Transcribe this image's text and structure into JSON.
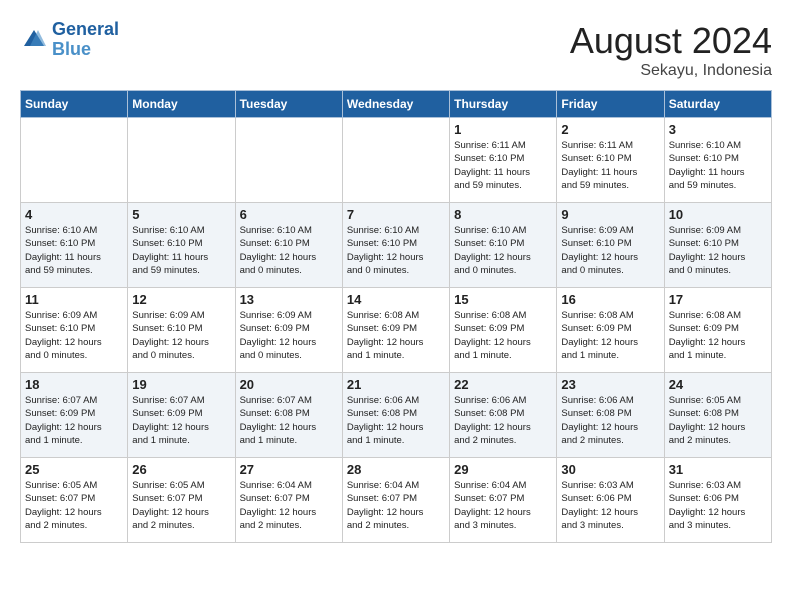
{
  "header": {
    "logo_line1": "General",
    "logo_line2": "Blue",
    "month_year": "August 2024",
    "location": "Sekayu, Indonesia"
  },
  "weekdays": [
    "Sunday",
    "Monday",
    "Tuesday",
    "Wednesday",
    "Thursday",
    "Friday",
    "Saturday"
  ],
  "weeks": [
    [
      {
        "day": "",
        "info": ""
      },
      {
        "day": "",
        "info": ""
      },
      {
        "day": "",
        "info": ""
      },
      {
        "day": "",
        "info": ""
      },
      {
        "day": "1",
        "info": "Sunrise: 6:11 AM\nSunset: 6:10 PM\nDaylight: 11 hours\nand 59 minutes."
      },
      {
        "day": "2",
        "info": "Sunrise: 6:11 AM\nSunset: 6:10 PM\nDaylight: 11 hours\nand 59 minutes."
      },
      {
        "day": "3",
        "info": "Sunrise: 6:10 AM\nSunset: 6:10 PM\nDaylight: 11 hours\nand 59 minutes."
      }
    ],
    [
      {
        "day": "4",
        "info": "Sunrise: 6:10 AM\nSunset: 6:10 PM\nDaylight: 11 hours\nand 59 minutes."
      },
      {
        "day": "5",
        "info": "Sunrise: 6:10 AM\nSunset: 6:10 PM\nDaylight: 11 hours\nand 59 minutes."
      },
      {
        "day": "6",
        "info": "Sunrise: 6:10 AM\nSunset: 6:10 PM\nDaylight: 12 hours\nand 0 minutes."
      },
      {
        "day": "7",
        "info": "Sunrise: 6:10 AM\nSunset: 6:10 PM\nDaylight: 12 hours\nand 0 minutes."
      },
      {
        "day": "8",
        "info": "Sunrise: 6:10 AM\nSunset: 6:10 PM\nDaylight: 12 hours\nand 0 minutes."
      },
      {
        "day": "9",
        "info": "Sunrise: 6:09 AM\nSunset: 6:10 PM\nDaylight: 12 hours\nand 0 minutes."
      },
      {
        "day": "10",
        "info": "Sunrise: 6:09 AM\nSunset: 6:10 PM\nDaylight: 12 hours\nand 0 minutes."
      }
    ],
    [
      {
        "day": "11",
        "info": "Sunrise: 6:09 AM\nSunset: 6:10 PM\nDaylight: 12 hours\nand 0 minutes."
      },
      {
        "day": "12",
        "info": "Sunrise: 6:09 AM\nSunset: 6:10 PM\nDaylight: 12 hours\nand 0 minutes."
      },
      {
        "day": "13",
        "info": "Sunrise: 6:09 AM\nSunset: 6:09 PM\nDaylight: 12 hours\nand 0 minutes."
      },
      {
        "day": "14",
        "info": "Sunrise: 6:08 AM\nSunset: 6:09 PM\nDaylight: 12 hours\nand 1 minute."
      },
      {
        "day": "15",
        "info": "Sunrise: 6:08 AM\nSunset: 6:09 PM\nDaylight: 12 hours\nand 1 minute."
      },
      {
        "day": "16",
        "info": "Sunrise: 6:08 AM\nSunset: 6:09 PM\nDaylight: 12 hours\nand 1 minute."
      },
      {
        "day": "17",
        "info": "Sunrise: 6:08 AM\nSunset: 6:09 PM\nDaylight: 12 hours\nand 1 minute."
      }
    ],
    [
      {
        "day": "18",
        "info": "Sunrise: 6:07 AM\nSunset: 6:09 PM\nDaylight: 12 hours\nand 1 minute."
      },
      {
        "day": "19",
        "info": "Sunrise: 6:07 AM\nSunset: 6:09 PM\nDaylight: 12 hours\nand 1 minute."
      },
      {
        "day": "20",
        "info": "Sunrise: 6:07 AM\nSunset: 6:08 PM\nDaylight: 12 hours\nand 1 minute."
      },
      {
        "day": "21",
        "info": "Sunrise: 6:06 AM\nSunset: 6:08 PM\nDaylight: 12 hours\nand 1 minute."
      },
      {
        "day": "22",
        "info": "Sunrise: 6:06 AM\nSunset: 6:08 PM\nDaylight: 12 hours\nand 2 minutes."
      },
      {
        "day": "23",
        "info": "Sunrise: 6:06 AM\nSunset: 6:08 PM\nDaylight: 12 hours\nand 2 minutes."
      },
      {
        "day": "24",
        "info": "Sunrise: 6:05 AM\nSunset: 6:08 PM\nDaylight: 12 hours\nand 2 minutes."
      }
    ],
    [
      {
        "day": "25",
        "info": "Sunrise: 6:05 AM\nSunset: 6:07 PM\nDaylight: 12 hours\nand 2 minutes."
      },
      {
        "day": "26",
        "info": "Sunrise: 6:05 AM\nSunset: 6:07 PM\nDaylight: 12 hours\nand 2 minutes."
      },
      {
        "day": "27",
        "info": "Sunrise: 6:04 AM\nSunset: 6:07 PM\nDaylight: 12 hours\nand 2 minutes."
      },
      {
        "day": "28",
        "info": "Sunrise: 6:04 AM\nSunset: 6:07 PM\nDaylight: 12 hours\nand 2 minutes."
      },
      {
        "day": "29",
        "info": "Sunrise: 6:04 AM\nSunset: 6:07 PM\nDaylight: 12 hours\nand 3 minutes."
      },
      {
        "day": "30",
        "info": "Sunrise: 6:03 AM\nSunset: 6:06 PM\nDaylight: 12 hours\nand 3 minutes."
      },
      {
        "day": "31",
        "info": "Sunrise: 6:03 AM\nSunset: 6:06 PM\nDaylight: 12 hours\nand 3 minutes."
      }
    ]
  ]
}
